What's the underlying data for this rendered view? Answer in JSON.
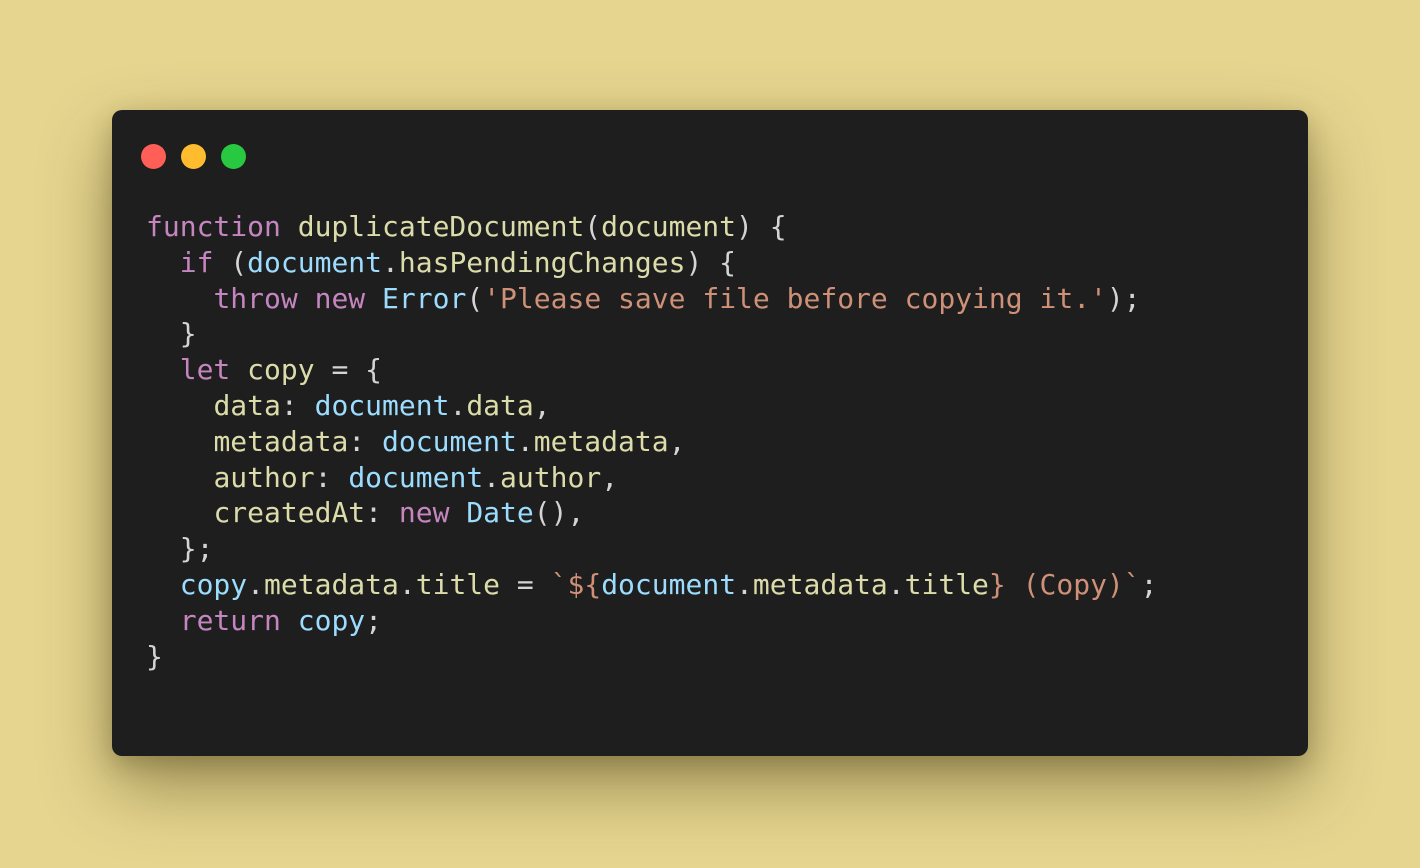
{
  "window": {
    "traffic_lights": [
      {
        "name": "close",
        "color": "#ff5f57"
      },
      {
        "name": "minimize",
        "color": "#febc2e"
      },
      {
        "name": "zoom",
        "color": "#28c840"
      }
    ]
  },
  "code": {
    "language": "javascript",
    "lines": [
      [
        {
          "t": "function",
          "k": "keyword"
        },
        {
          "t": " ",
          "k": "plain"
        },
        {
          "t": "duplicateDocument",
          "k": "function"
        },
        {
          "t": "(",
          "k": "punct"
        },
        {
          "t": "document",
          "k": "param"
        },
        {
          "t": ") {",
          "k": "punct"
        }
      ],
      [
        {
          "t": "  ",
          "k": "plain"
        },
        {
          "t": "if",
          "k": "keyword"
        },
        {
          "t": " (",
          "k": "punct"
        },
        {
          "t": "document",
          "k": "variable"
        },
        {
          "t": ".",
          "k": "punct"
        },
        {
          "t": "hasPendingChanges",
          "k": "property"
        },
        {
          "t": ") {",
          "k": "punct"
        }
      ],
      [
        {
          "t": "    ",
          "k": "plain"
        },
        {
          "t": "throw",
          "k": "keyword"
        },
        {
          "t": " ",
          "k": "plain"
        },
        {
          "t": "new",
          "k": "keyword"
        },
        {
          "t": " ",
          "k": "plain"
        },
        {
          "t": "Error",
          "k": "class"
        },
        {
          "t": "(",
          "k": "punct"
        },
        {
          "t": "'Please save file before copying it.'",
          "k": "string"
        },
        {
          "t": ");",
          "k": "punct"
        }
      ],
      [
        {
          "t": "  }",
          "k": "punct"
        }
      ],
      [
        {
          "t": "  ",
          "k": "plain"
        },
        {
          "t": "let",
          "k": "keyword"
        },
        {
          "t": " ",
          "k": "plain"
        },
        {
          "t": "copy",
          "k": "param"
        },
        {
          "t": " = {",
          "k": "punct"
        }
      ],
      [
        {
          "t": "    ",
          "k": "plain"
        },
        {
          "t": "data",
          "k": "property"
        },
        {
          "t": ": ",
          "k": "punct"
        },
        {
          "t": "document",
          "k": "variable"
        },
        {
          "t": ".",
          "k": "punct"
        },
        {
          "t": "data",
          "k": "property"
        },
        {
          "t": ",",
          "k": "punct"
        }
      ],
      [
        {
          "t": "    ",
          "k": "plain"
        },
        {
          "t": "metadata",
          "k": "property"
        },
        {
          "t": ": ",
          "k": "punct"
        },
        {
          "t": "document",
          "k": "variable"
        },
        {
          "t": ".",
          "k": "punct"
        },
        {
          "t": "metadata",
          "k": "property"
        },
        {
          "t": ",",
          "k": "punct"
        }
      ],
      [
        {
          "t": "    ",
          "k": "plain"
        },
        {
          "t": "author",
          "k": "property"
        },
        {
          "t": ": ",
          "k": "punct"
        },
        {
          "t": "document",
          "k": "variable"
        },
        {
          "t": ".",
          "k": "punct"
        },
        {
          "t": "author",
          "k": "property"
        },
        {
          "t": ",",
          "k": "punct"
        }
      ],
      [
        {
          "t": "    ",
          "k": "plain"
        },
        {
          "t": "createdAt",
          "k": "property"
        },
        {
          "t": ": ",
          "k": "punct"
        },
        {
          "t": "new",
          "k": "keyword"
        },
        {
          "t": " ",
          "k": "plain"
        },
        {
          "t": "Date",
          "k": "class"
        },
        {
          "t": "(),",
          "k": "punct"
        }
      ],
      [
        {
          "t": "  };",
          "k": "punct"
        }
      ],
      [
        {
          "t": "  ",
          "k": "plain"
        },
        {
          "t": "copy",
          "k": "variable"
        },
        {
          "t": ".",
          "k": "punct"
        },
        {
          "t": "metadata",
          "k": "property"
        },
        {
          "t": ".",
          "k": "punct"
        },
        {
          "t": "title",
          "k": "property"
        },
        {
          "t": " = ",
          "k": "punct"
        },
        {
          "t": "`${",
          "k": "string"
        },
        {
          "t": "document",
          "k": "variable"
        },
        {
          "t": ".",
          "k": "punct"
        },
        {
          "t": "metadata",
          "k": "property"
        },
        {
          "t": ".",
          "k": "punct"
        },
        {
          "t": "title",
          "k": "property"
        },
        {
          "t": "} (Copy)`",
          "k": "string"
        },
        {
          "t": ";",
          "k": "punct"
        }
      ],
      [
        {
          "t": "  ",
          "k": "plain"
        },
        {
          "t": "return",
          "k": "keyword"
        },
        {
          "t": " ",
          "k": "plain"
        },
        {
          "t": "copy",
          "k": "variable"
        },
        {
          "t": ";",
          "k": "punct"
        }
      ],
      [
        {
          "t": "}",
          "k": "punct"
        }
      ]
    ]
  }
}
